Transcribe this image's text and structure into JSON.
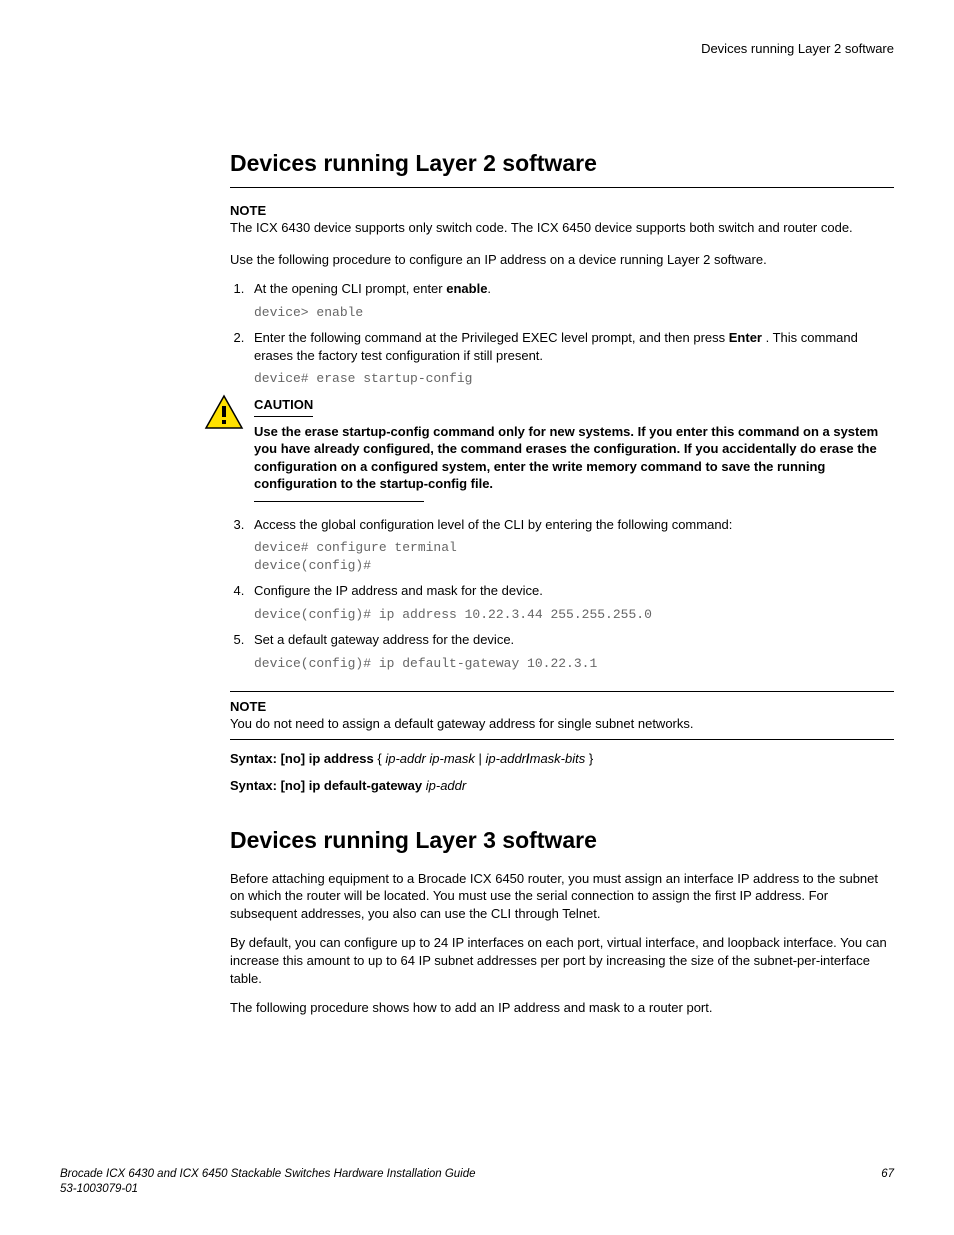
{
  "header": {
    "right": "Devices running Layer 2 software"
  },
  "h1": "Devices running Layer 2 software",
  "note1": {
    "label": "NOTE",
    "text": "The ICX 6430 device supports only switch code. The ICX 6450 device supports both switch and router code."
  },
  "intro": "Use the following procedure to configure an IP address on a device running Layer 2 software.",
  "steps": {
    "s1": {
      "pre": "At the opening CLI prompt, enter ",
      "bold": "enable",
      "post": ".",
      "code": "device> enable"
    },
    "s2": {
      "pre": "Enter the following command at the Privileged EXEC level prompt, and then press ",
      "bold": "Enter",
      "post": " . This command erases the factory test configuration if still present.",
      "code": "device# erase startup-config"
    },
    "s3": {
      "text": "Access the global configuration level of the CLI by entering the following command:",
      "code": "device# configure terminal\ndevice(config)#"
    },
    "s4": {
      "text": "Configure the IP address and mask for the device.",
      "code": "device(config)# ip address 10.22.3.44 255.255.255.0"
    },
    "s5": {
      "text": "Set a default gateway address for the device.",
      "code": "device(config)# ip default-gateway 10.22.3.1"
    }
  },
  "caution": {
    "label": "CAUTION",
    "text": "Use the erase startup-config command only for new systems. If you enter this command on a system you have already configured, the command erases the configuration. If you accidentally do erase the configuration on a configured system, enter the write memory command to save the running configuration to the startup-config file."
  },
  "note2": {
    "label": "NOTE",
    "text": "You do not need to assign a default gateway address for single subnet networks."
  },
  "syntax1": {
    "b1": "Syntax: [no] ip address",
    "plain1": " { ",
    "i1": "ip-addr ip-mask",
    "plain2": " | ",
    "i2": "ip-addr",
    "b2": "/",
    "i3": "mask-bits",
    "plain3": " }"
  },
  "syntax2": {
    "b1": "Syntax: [no] ip default-gateway",
    "i1": " ip-addr"
  },
  "h2": "Devices running Layer 3 software",
  "l3p1": "Before attaching equipment to a Brocade ICX 6450 router, you must assign an interface IP address to the subnet on which the router will be located. You must use the serial connection to assign the first IP address. For subsequent addresses, you also can use the CLI through Telnet.",
  "l3p2": "By default, you can configure up to 24 IP interfaces on each port, virtual interface, and loopback interface. You can increase this amount to up to 64 IP subnet addresses per port by increasing the size of the subnet-per-interface table.",
  "l3p3": "The following procedure shows how to add an IP address and mask to a router port.",
  "footer": {
    "title": "Brocade ICX 6430 and ICX 6450 Stackable Switches Hardware Installation Guide",
    "docnum": "53-1003079-01",
    "page": "67"
  }
}
